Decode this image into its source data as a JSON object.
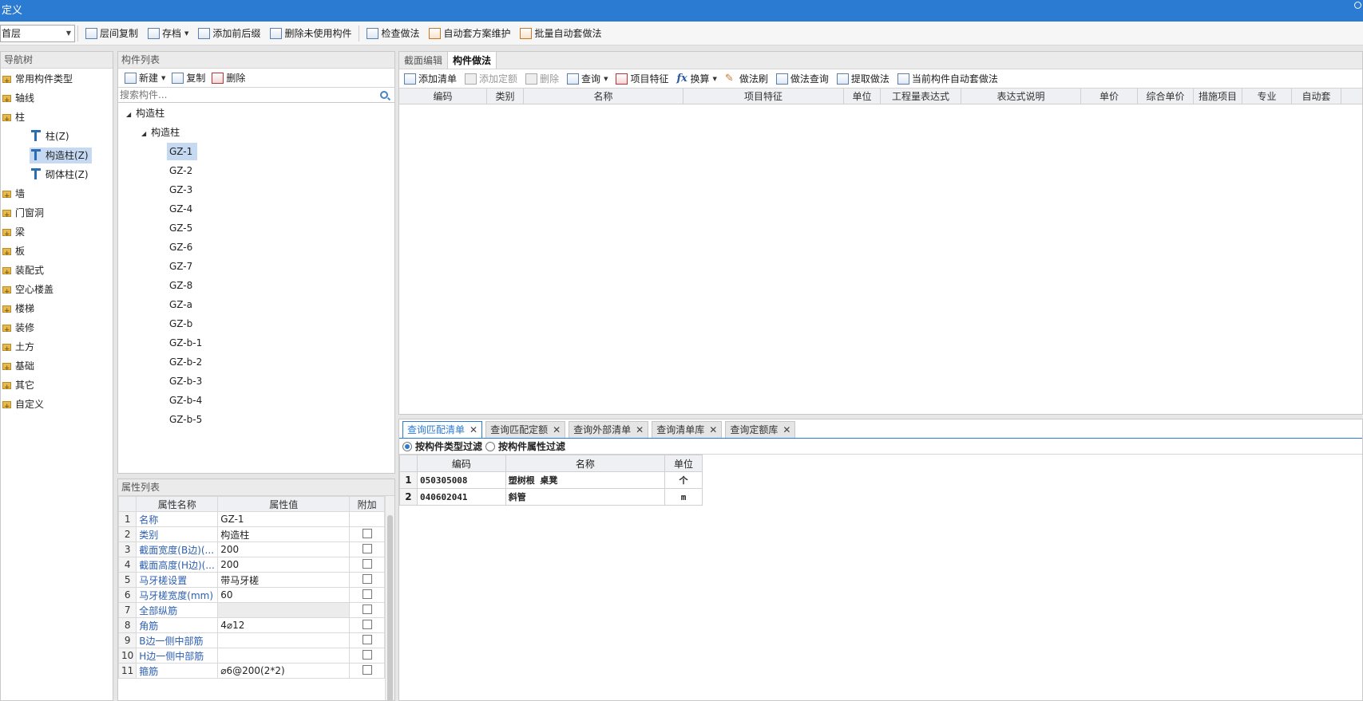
{
  "window": {
    "title": "定义"
  },
  "toolbar": {
    "floor": "首层",
    "buttons": [
      "层间复制",
      "存档",
      "添加前后缀",
      "删除未使用构件",
      "检查做法",
      "自动套方案维护",
      "批量自动套做法"
    ]
  },
  "nav": {
    "header": "导航树",
    "items": [
      {
        "label": "常用构件类型",
        "type": "folder"
      },
      {
        "label": "轴线",
        "type": "folder"
      },
      {
        "label": "柱",
        "type": "folder"
      },
      {
        "label": "柱(Z)",
        "type": "child"
      },
      {
        "label": "构造柱(Z)",
        "type": "child",
        "selected": true
      },
      {
        "label": "砌体柱(Z)",
        "type": "child"
      },
      {
        "label": "墙",
        "type": "folder"
      },
      {
        "label": "门窗洞",
        "type": "folder"
      },
      {
        "label": "梁",
        "type": "folder"
      },
      {
        "label": "板",
        "type": "folder"
      },
      {
        "label": "装配式",
        "type": "folder"
      },
      {
        "label": "空心楼盖",
        "type": "folder"
      },
      {
        "label": "楼梯",
        "type": "folder"
      },
      {
        "label": "装修",
        "type": "folder"
      },
      {
        "label": "土方",
        "type": "folder"
      },
      {
        "label": "基础",
        "type": "folder"
      },
      {
        "label": "其它",
        "type": "folder"
      },
      {
        "label": "自定义",
        "type": "folder"
      }
    ]
  },
  "component_list": {
    "header": "构件列表",
    "new_label": "新建",
    "copy_label": "复制",
    "delete_label": "删除",
    "search_placeholder": "搜索构件...",
    "root": "构造柱",
    "group": "构造柱",
    "items": [
      "GZ-1",
      "GZ-2",
      "GZ-3",
      "GZ-4",
      "GZ-5",
      "GZ-6",
      "GZ-7",
      "GZ-8",
      "GZ-a",
      "GZ-b",
      "GZ-b-1",
      "GZ-b-2",
      "GZ-b-3",
      "GZ-b-4",
      "GZ-b-5"
    ]
  },
  "properties": {
    "header": "属性列表",
    "columns": [
      "属性名称",
      "属性值",
      "附加"
    ],
    "rows": [
      {
        "n": "1",
        "name": "名称",
        "value": "GZ-1",
        "check": false
      },
      {
        "n": "2",
        "name": "类别",
        "value": "构造柱",
        "check": true
      },
      {
        "n": "3",
        "name": "截面宽度(B边)(...",
        "value": "200",
        "check": true
      },
      {
        "n": "4",
        "name": "截面高度(H边)(...",
        "value": "200",
        "check": true
      },
      {
        "n": "5",
        "name": "马牙槎设置",
        "value": "带马牙槎",
        "check": true
      },
      {
        "n": "6",
        "name": "马牙槎宽度(mm)",
        "value": "60",
        "check": true
      },
      {
        "n": "7",
        "name": "全部纵筋",
        "value": "",
        "check": true,
        "gray": true
      },
      {
        "n": "8",
        "name": "角筋",
        "value": "4⌀12",
        "check": true
      },
      {
        "n": "9",
        "name": "B边一侧中部筋",
        "value": "",
        "check": true
      },
      {
        "n": "10",
        "name": "H边一侧中部筋",
        "value": "",
        "check": true
      },
      {
        "n": "11",
        "name": "箍筋",
        "value": "⌀6@200(2*2)",
        "check": true
      }
    ]
  },
  "right": {
    "tabs": [
      "截面编辑",
      "构件做法"
    ],
    "active_tab": 1,
    "toolbar": [
      "添加清单",
      "添加定额",
      "删除",
      "查询",
      "项目特征",
      "换算",
      "做法刷",
      "做法查询",
      "提取做法",
      "当前构件自动套做法"
    ],
    "grid_columns": [
      "编码",
      "类别",
      "名称",
      "项目特征",
      "单位",
      "工程量表达式",
      "表达式说明",
      "单价",
      "综合单价",
      "措施项目",
      "专业",
      "自动套"
    ]
  },
  "bottom": {
    "tabs": [
      "查询匹配清单",
      "查询匹配定额",
      "查询外部清单",
      "查询清单库",
      "查询定额库"
    ],
    "filter_type": "按构件类型过滤",
    "filter_attr": "按构件属性过滤",
    "columns": [
      "编码",
      "名称",
      "单位"
    ],
    "rows": [
      {
        "n": "1",
        "code": "050305008",
        "name": "塑树根 桌凳",
        "unit": "个"
      },
      {
        "n": "2",
        "code": "040602041",
        "name": "斜管",
        "unit": "m"
      }
    ]
  }
}
